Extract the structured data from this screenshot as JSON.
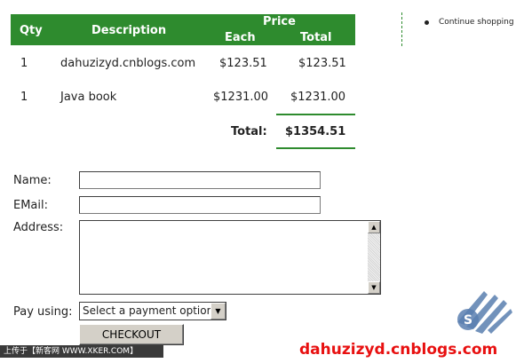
{
  "cart": {
    "headers": {
      "qty": "Qty",
      "description": "Description",
      "price": "Price",
      "each": "Each",
      "total": "Total"
    },
    "rows": [
      {
        "qty": "1",
        "description": "dahuzizyd.cnblogs.com",
        "each": "$123.51",
        "total": "$123.51"
      },
      {
        "qty": "1",
        "description": "Java book",
        "each": "$1231.00",
        "total": "$1231.00"
      }
    ],
    "total_label": "Total:",
    "total_value": "$1354.51"
  },
  "sidebar": {
    "continue_shopping": "Continue shopping"
  },
  "form": {
    "name_label": "Name:",
    "email_label": "EMail:",
    "address_label": "Address:",
    "pay_label": "Pay using:",
    "name_value": "",
    "email_value": "",
    "payment_selected": "Select a payment option",
    "checkout_label": "CHECKOUT"
  },
  "footer": {
    "upload_text": "上传于【新客网 WWW.XKER.COM】",
    "watermark": "dahuzizyd.cnblogs.com"
  },
  "colors": {
    "header_green": "#2e8b2e",
    "watermark_red": "#e81010"
  }
}
